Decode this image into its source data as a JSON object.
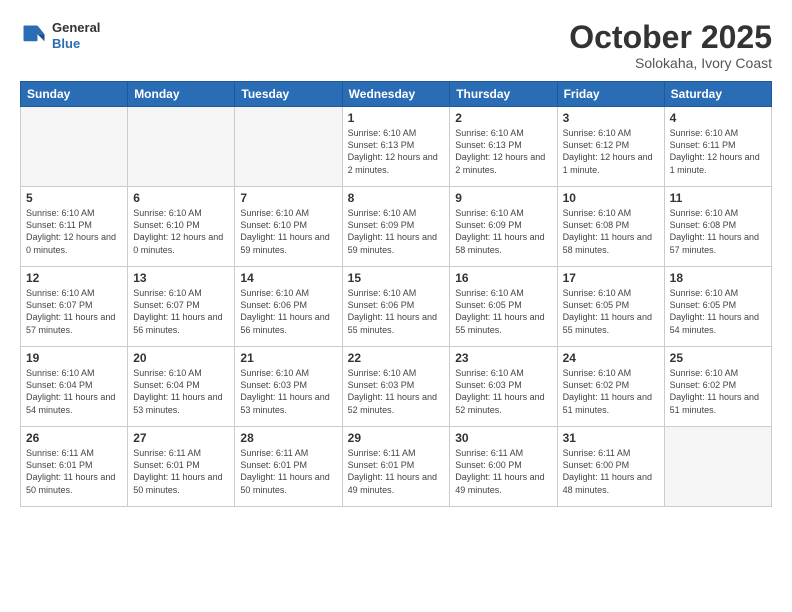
{
  "header": {
    "logo_general": "General",
    "logo_blue": "Blue",
    "month": "October 2025",
    "location": "Solokaha, Ivory Coast"
  },
  "days_of_week": [
    "Sunday",
    "Monday",
    "Tuesday",
    "Wednesday",
    "Thursday",
    "Friday",
    "Saturday"
  ],
  "weeks": [
    [
      {
        "day": "",
        "info": ""
      },
      {
        "day": "",
        "info": ""
      },
      {
        "day": "",
        "info": ""
      },
      {
        "day": "1",
        "info": "Sunrise: 6:10 AM\nSunset: 6:13 PM\nDaylight: 12 hours and 2 minutes."
      },
      {
        "day": "2",
        "info": "Sunrise: 6:10 AM\nSunset: 6:13 PM\nDaylight: 12 hours and 2 minutes."
      },
      {
        "day": "3",
        "info": "Sunrise: 6:10 AM\nSunset: 6:12 PM\nDaylight: 12 hours and 1 minute."
      },
      {
        "day": "4",
        "info": "Sunrise: 6:10 AM\nSunset: 6:11 PM\nDaylight: 12 hours and 1 minute."
      }
    ],
    [
      {
        "day": "5",
        "info": "Sunrise: 6:10 AM\nSunset: 6:11 PM\nDaylight: 12 hours and 0 minutes."
      },
      {
        "day": "6",
        "info": "Sunrise: 6:10 AM\nSunset: 6:10 PM\nDaylight: 12 hours and 0 minutes."
      },
      {
        "day": "7",
        "info": "Sunrise: 6:10 AM\nSunset: 6:10 PM\nDaylight: 11 hours and 59 minutes."
      },
      {
        "day": "8",
        "info": "Sunrise: 6:10 AM\nSunset: 6:09 PM\nDaylight: 11 hours and 59 minutes."
      },
      {
        "day": "9",
        "info": "Sunrise: 6:10 AM\nSunset: 6:09 PM\nDaylight: 11 hours and 58 minutes."
      },
      {
        "day": "10",
        "info": "Sunrise: 6:10 AM\nSunset: 6:08 PM\nDaylight: 11 hours and 58 minutes."
      },
      {
        "day": "11",
        "info": "Sunrise: 6:10 AM\nSunset: 6:08 PM\nDaylight: 11 hours and 57 minutes."
      }
    ],
    [
      {
        "day": "12",
        "info": "Sunrise: 6:10 AM\nSunset: 6:07 PM\nDaylight: 11 hours and 57 minutes."
      },
      {
        "day": "13",
        "info": "Sunrise: 6:10 AM\nSunset: 6:07 PM\nDaylight: 11 hours and 56 minutes."
      },
      {
        "day": "14",
        "info": "Sunrise: 6:10 AM\nSunset: 6:06 PM\nDaylight: 11 hours and 56 minutes."
      },
      {
        "day": "15",
        "info": "Sunrise: 6:10 AM\nSunset: 6:06 PM\nDaylight: 11 hours and 55 minutes."
      },
      {
        "day": "16",
        "info": "Sunrise: 6:10 AM\nSunset: 6:05 PM\nDaylight: 11 hours and 55 minutes."
      },
      {
        "day": "17",
        "info": "Sunrise: 6:10 AM\nSunset: 6:05 PM\nDaylight: 11 hours and 55 minutes."
      },
      {
        "day": "18",
        "info": "Sunrise: 6:10 AM\nSunset: 6:05 PM\nDaylight: 11 hours and 54 minutes."
      }
    ],
    [
      {
        "day": "19",
        "info": "Sunrise: 6:10 AM\nSunset: 6:04 PM\nDaylight: 11 hours and 54 minutes."
      },
      {
        "day": "20",
        "info": "Sunrise: 6:10 AM\nSunset: 6:04 PM\nDaylight: 11 hours and 53 minutes."
      },
      {
        "day": "21",
        "info": "Sunrise: 6:10 AM\nSunset: 6:03 PM\nDaylight: 11 hours and 53 minutes."
      },
      {
        "day": "22",
        "info": "Sunrise: 6:10 AM\nSunset: 6:03 PM\nDaylight: 11 hours and 52 minutes."
      },
      {
        "day": "23",
        "info": "Sunrise: 6:10 AM\nSunset: 6:03 PM\nDaylight: 11 hours and 52 minutes."
      },
      {
        "day": "24",
        "info": "Sunrise: 6:10 AM\nSunset: 6:02 PM\nDaylight: 11 hours and 51 minutes."
      },
      {
        "day": "25",
        "info": "Sunrise: 6:10 AM\nSunset: 6:02 PM\nDaylight: 11 hours and 51 minutes."
      }
    ],
    [
      {
        "day": "26",
        "info": "Sunrise: 6:11 AM\nSunset: 6:01 PM\nDaylight: 11 hours and 50 minutes."
      },
      {
        "day": "27",
        "info": "Sunrise: 6:11 AM\nSunset: 6:01 PM\nDaylight: 11 hours and 50 minutes."
      },
      {
        "day": "28",
        "info": "Sunrise: 6:11 AM\nSunset: 6:01 PM\nDaylight: 11 hours and 50 minutes."
      },
      {
        "day": "29",
        "info": "Sunrise: 6:11 AM\nSunset: 6:01 PM\nDaylight: 11 hours and 49 minutes."
      },
      {
        "day": "30",
        "info": "Sunrise: 6:11 AM\nSunset: 6:00 PM\nDaylight: 11 hours and 49 minutes."
      },
      {
        "day": "31",
        "info": "Sunrise: 6:11 AM\nSunset: 6:00 PM\nDaylight: 11 hours and 48 minutes."
      },
      {
        "day": "",
        "info": ""
      }
    ]
  ]
}
